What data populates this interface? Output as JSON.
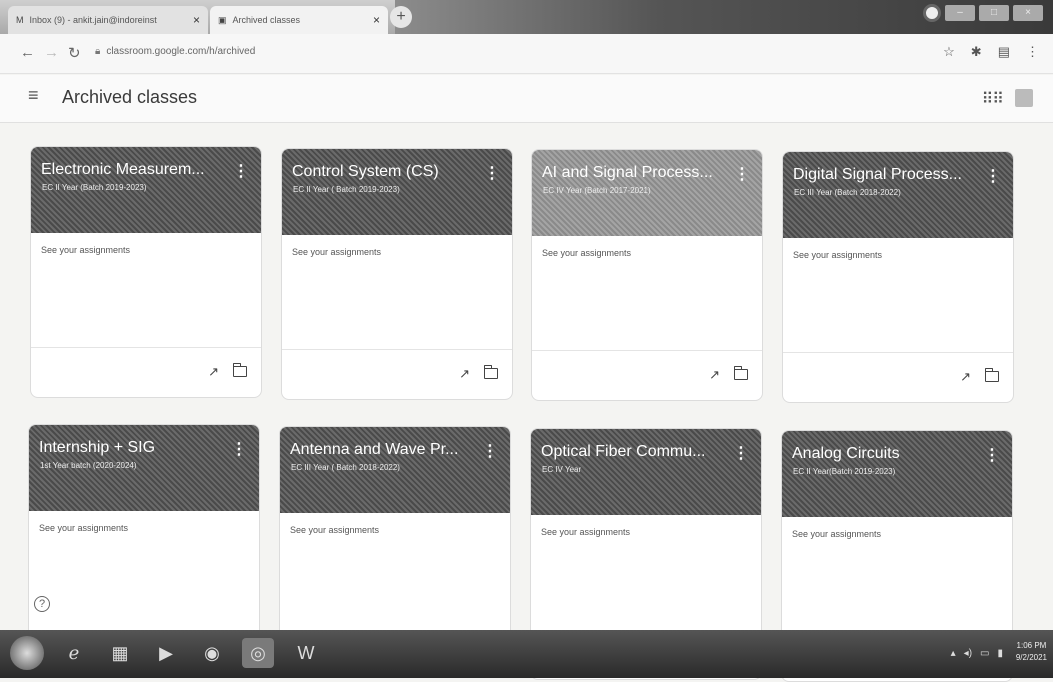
{
  "browser": {
    "tabs": [
      {
        "label": "Inbox (9) - ankit.jain@indoreinst",
        "favicon": "M"
      },
      {
        "label": "Archived classes",
        "favicon": "▣"
      }
    ],
    "url": "classroom.google.com/h/archived"
  },
  "header": {
    "title": "Archived classes"
  },
  "cards": [
    {
      "name": "Electronic Measurem...",
      "section": "EC II Year (Batch 2019-2023)",
      "assignments": "See your assignments"
    },
    {
      "name": "Control System (CS)",
      "section": "EC II Year ( Batch 2019-2023)",
      "assignments": "See your assignments"
    },
    {
      "name": "AI and Signal Process...",
      "section": "EC IV Year (Batch 2017-2021)",
      "assignments": "See your assignments"
    },
    {
      "name": "Digital Signal Process...",
      "section": "EC III Year (Batch 2018-2022)",
      "assignments": "See your assignments"
    },
    {
      "name": "Internship + SIG",
      "section": "1st Year batch (2020-2024)",
      "assignments": "See your assignments"
    },
    {
      "name": "Antenna and Wave Pr...",
      "section": "EC III Year ( Batch 2018-2022)",
      "assignments": "See your assignments"
    },
    {
      "name": "Optical Fiber Commu...",
      "section": "EC IV Year",
      "assignments": "See your assignments"
    },
    {
      "name": "Analog Circuits",
      "section": "EC II Year(Batch 2019-2023)",
      "assignments": "See your assignments"
    }
  ],
  "taskbar": {
    "time": "1:06 PM",
    "date": "9/2/2021"
  }
}
